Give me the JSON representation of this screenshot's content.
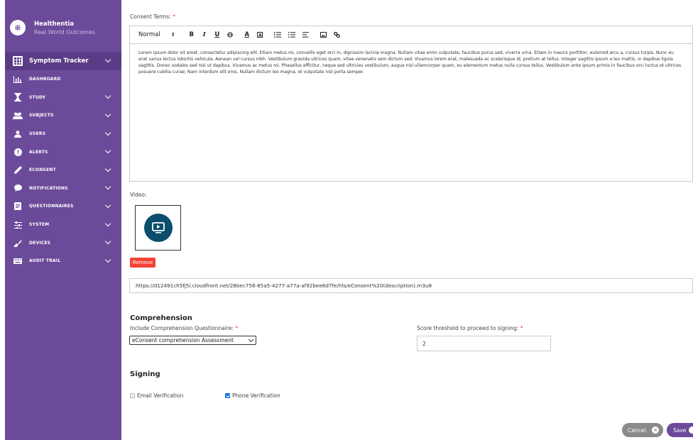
{
  "brand": {
    "name": "Healthentia",
    "subtitle": "Real World Outcomes"
  },
  "sidebar": {
    "items": [
      {
        "label": "Symptom Tracker",
        "icon": "grid-icon"
      },
      {
        "label": "Dashboard",
        "icon": "bar-chart-icon"
      },
      {
        "label": "Study",
        "icon": "hourglass-icon"
      },
      {
        "label": "Subjects",
        "icon": "group-icon"
      },
      {
        "label": "Users",
        "icon": "user-icon"
      },
      {
        "label": "Alerts",
        "icon": "alert-icon"
      },
      {
        "label": "eConsent",
        "icon": "pencil-icon"
      },
      {
        "label": "Notifications",
        "icon": "chat-icon"
      },
      {
        "label": "Questionnaires",
        "icon": "document-icon"
      },
      {
        "label": "System",
        "icon": "sliders-icon"
      },
      {
        "label": "Devices",
        "icon": "device-icon"
      },
      {
        "label": "Audit Trail",
        "icon": "keyboard-icon"
      }
    ]
  },
  "consent": {
    "label": "Consent Terms:",
    "required_mark": "*",
    "toolbar": {
      "format": "Normal"
    },
    "body": "Lorem ipsum dolor sit amet, consectetur adipiscing elit. Etiam metus mi, convallis eget orci in, dignissim lacinia magna. Nullam vitae enim vulputate, faucibus purus sed, viverra urna. Etiam in mauris porttitor, euismod arcu a, cursus turpis. Nunc eu erat varius lectus lobortis vehicula. Aenean vel cursus nibh. Vestibulum gravida ultrices quam, vitae venenatis sem dictum sed. Vivamus lorem erat, malesuada ac scelerisque id, pretium at tellus. Integer sagittis ipsum a leo mattis, in dapibus ligula sagittis. Donec sodales sed nisi ut dapibus. Vivamus ac metus mi. Phasellus efficitur, neque sed ultricies vestibulum, augue nisl ullamcorper quam, eu elementum metus nulla cursus tellus. Vestibulum ante ipsum primis in faucibus orci luctus et ultrices posuere cubilia curae; Nam interdum elit eros. Nullam dictum leo magna, et vulputate nisl porta semper."
  },
  "video": {
    "label": "Video:",
    "remove_label": "Remove",
    "url": "https://d12491ch5fj5i.cloudfront.net/28bec756-85a5-4277-a77a-af92bee6d7fe/hls/eConsent%20(description).m3u8"
  },
  "comprehension": {
    "heading": "Comprehension",
    "include_label": "Include Comprehension Questionnaire:",
    "selected": "eConsent comprehension Assessment",
    "threshold_label": "Score threshold to proceed to signing:",
    "threshold_value": "2",
    "required_mark": "*"
  },
  "signing": {
    "heading": "Signing",
    "email_label": "Email Verification",
    "email_checked": false,
    "phone_label": "Phone Verification",
    "phone_checked": true
  },
  "actions": {
    "cancel_label": "Cancel",
    "save_label": "Save"
  }
}
